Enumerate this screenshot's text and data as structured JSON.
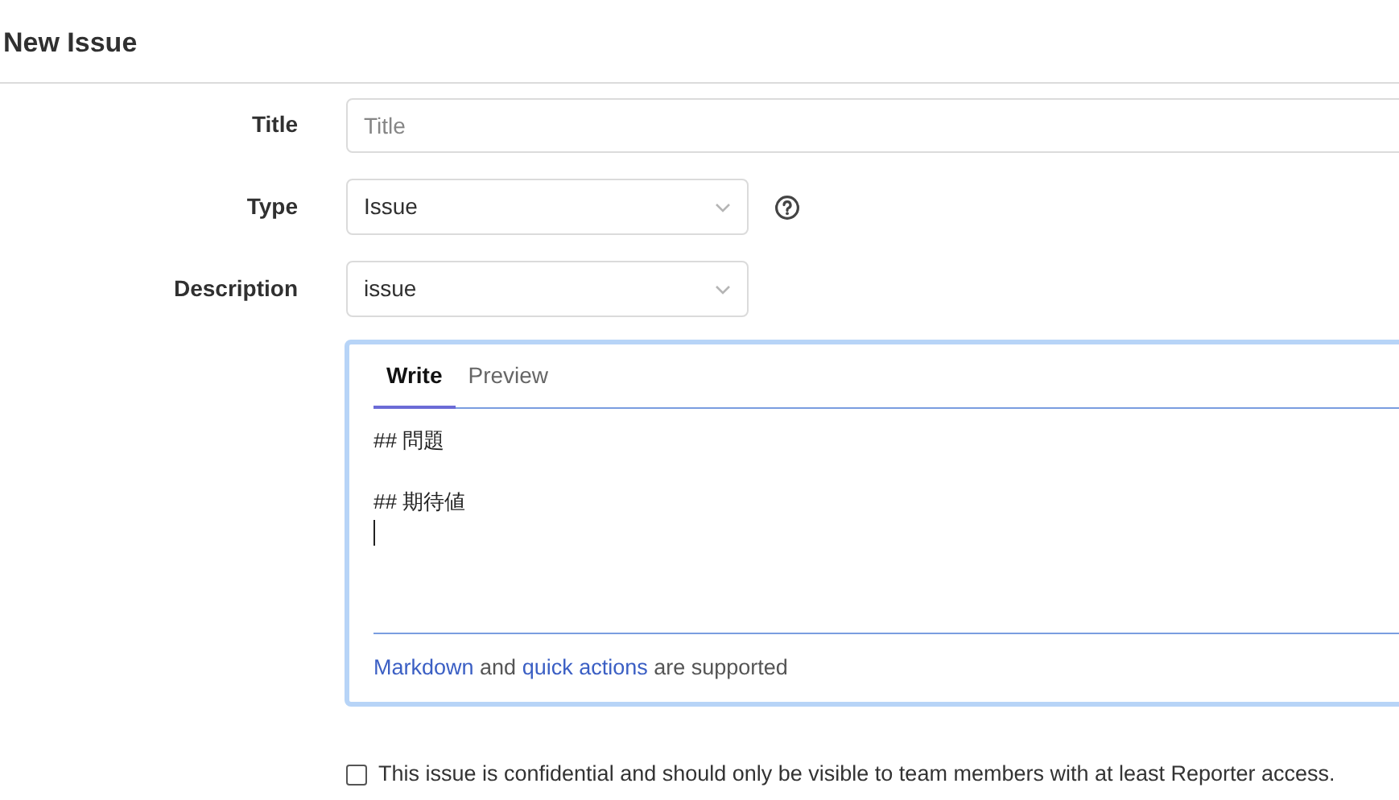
{
  "page_title": "New Issue",
  "fields": [
    {
      "kind": "text",
      "label": "Title",
      "placeholder": "Title"
    },
    {
      "kind": "select",
      "label": "Type",
      "value": "Issue",
      "help": true
    },
    {
      "kind": "select",
      "label": "Description",
      "value": "issue",
      "help": false
    }
  ],
  "editor": {
    "tabs": [
      {
        "label": "Write",
        "selected": true
      },
      {
        "label": "Preview",
        "selected": false
      }
    ],
    "lines": [
      "## 問題",
      "## 期待値"
    ],
    "hint": [
      {
        "kind": "link",
        "text": "Markdown"
      },
      {
        "kind": "text",
        "text": " and "
      },
      {
        "kind": "link",
        "text": "quick actions"
      },
      {
        "kind": "text",
        "text": " are supported"
      }
    ]
  },
  "confidential": {
    "checked": false,
    "label": "This issue is confidential and should only be visible to team members with at least Reporter access."
  }
}
